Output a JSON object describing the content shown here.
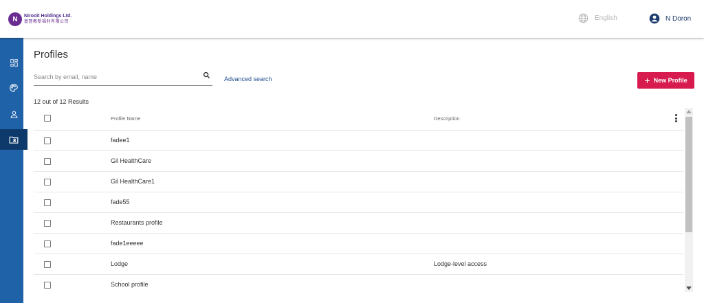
{
  "header": {
    "logo_text": "Nirooit Holdings Ltd.",
    "logo_subtext": "基督教新福利有限公司",
    "language": "English",
    "user_name": "N Doron"
  },
  "sidebar": {
    "items": [
      {
        "icon": "dashboard-icon"
      },
      {
        "icon": "palette-icon"
      },
      {
        "icon": "person-icon"
      },
      {
        "icon": "profile-card-icon",
        "active": true
      }
    ]
  },
  "main": {
    "title": "Profiles",
    "search_placeholder": "Search by email, name",
    "advanced_search": "Advanced search",
    "new_button": "New Profile",
    "results_count": "12 out of 12 Results"
  },
  "table": {
    "headers": {
      "name": "Profile Name",
      "description": "Description"
    },
    "rows": [
      {
        "name": "fadee1",
        "description": ""
      },
      {
        "name": "Gil HealthCare",
        "description": ""
      },
      {
        "name": "Gil HealthCare1",
        "description": ""
      },
      {
        "name": "fade55",
        "description": ""
      },
      {
        "name": "Restaurants profile",
        "description": ""
      },
      {
        "name": "fade1eeeee",
        "description": ""
      },
      {
        "name": "Lodge",
        "description": "Lodge-level access"
      },
      {
        "name": "School profile",
        "description": ""
      }
    ]
  },
  "colors": {
    "sidebar": "#2062a8",
    "sidebar_active": "#0e3a6b",
    "accent": "#d81b4f",
    "link": "#1f4e8c"
  }
}
